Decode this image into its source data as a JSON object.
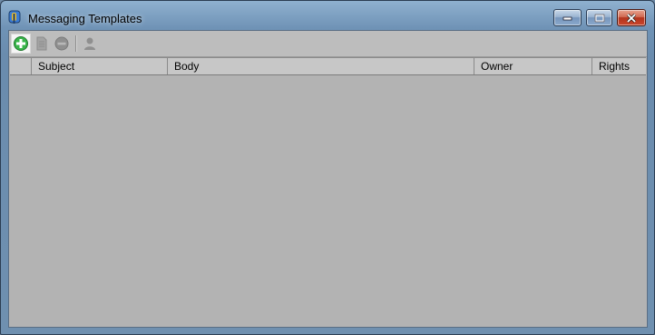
{
  "window": {
    "title": "Messaging Templates",
    "controls": [
      "minimize",
      "maximize",
      "close"
    ]
  },
  "toolbar": {
    "buttons": [
      {
        "name": "add",
        "icon": "plus-circle-icon",
        "enabled": true
      },
      {
        "name": "edit",
        "icon": "document-icon",
        "enabled": false
      },
      {
        "name": "remove",
        "icon": "minus-circle-icon",
        "enabled": false
      },
      {
        "name": "rights",
        "icon": "user-icon",
        "enabled": false
      }
    ]
  },
  "grid": {
    "columns": [
      "",
      "Subject",
      "Body",
      "Owner",
      "Rights"
    ],
    "rows": []
  },
  "colors": {
    "accent_add": "#39b54a",
    "client_bg": "#b3b3b3",
    "frame": "#6f93b6"
  }
}
